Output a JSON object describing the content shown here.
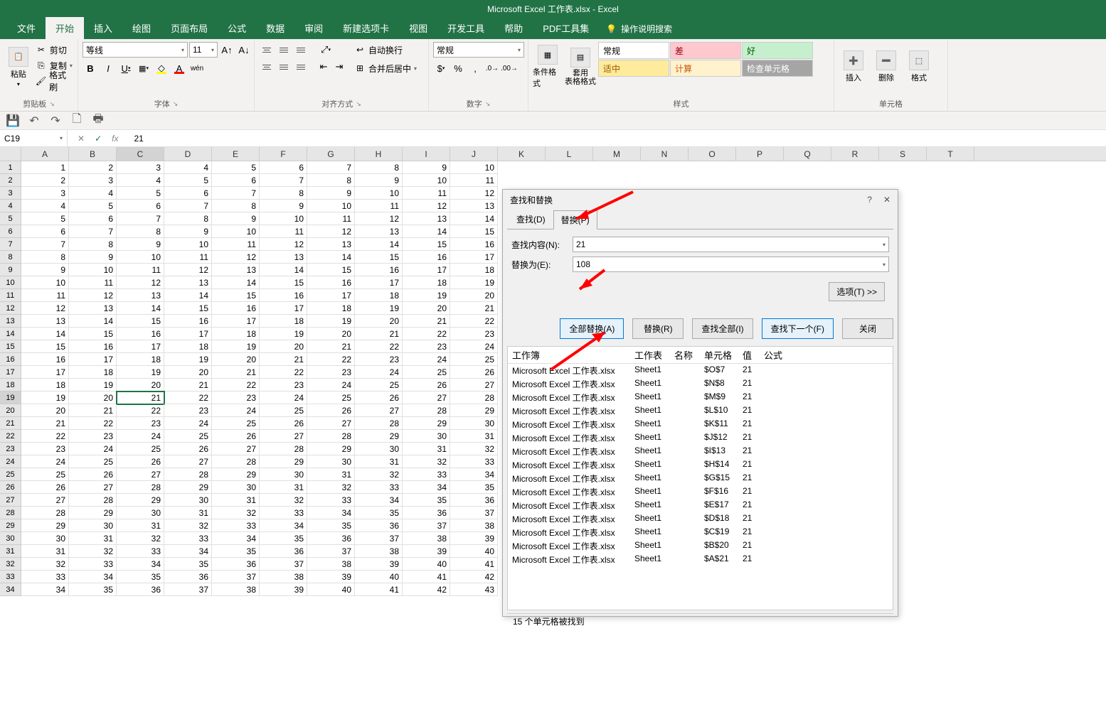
{
  "title": "Microsoft Excel 工作表.xlsx  -  Excel",
  "menu": [
    "文件",
    "开始",
    "插入",
    "绘图",
    "页面布局",
    "公式",
    "数据",
    "审阅",
    "新建选项卡",
    "视图",
    "开发工具",
    "帮助",
    "PDF工具集"
  ],
  "menu_active": 1,
  "tell_me": "操作说明搜索",
  "ribbon": {
    "clipboard": {
      "label": "剪贴板",
      "paste": "粘贴",
      "cut": "剪切",
      "copy": "复制",
      "format_painter": "格式刷"
    },
    "font": {
      "label": "字体",
      "name": "等线",
      "size": "11"
    },
    "align": {
      "label": "对齐方式",
      "wrap": "自动换行",
      "merge": "合并后居中"
    },
    "number": {
      "label": "数字",
      "format": "常规"
    },
    "styles": {
      "label": "样式",
      "cond": "条件格式",
      "table": "套用\n表格格式",
      "cells": [
        {
          "t": "常规",
          "bg": "#ffffff",
          "c": "#000"
        },
        {
          "t": "差",
          "bg": "#ffc7ce",
          "c": "#9c0006"
        },
        {
          "t": "好",
          "bg": "#c6efce",
          "c": "#006100"
        },
        {
          "t": "适中",
          "bg": "#ffeb9c",
          "c": "#9c5700"
        },
        {
          "t": "计算",
          "bg": "#fff2cc",
          "c": "#c65911"
        },
        {
          "t": "检查单元格",
          "bg": "#a5a5a5",
          "c": "#fff"
        }
      ]
    },
    "cells_group": {
      "label": "单元格",
      "insert": "插入",
      "delete": "删除",
      "format": "格式"
    }
  },
  "namebox": "C19",
  "formula": "21",
  "columns": [
    "A",
    "B",
    "C",
    "D",
    "E",
    "F",
    "G",
    "H",
    "I",
    "J",
    "K",
    "L",
    "M",
    "N",
    "O",
    "P",
    "Q",
    "R",
    "S",
    "T"
  ],
  "active_cell": {
    "row": 19,
    "col": 3
  },
  "grid_rows": 34,
  "grid_cols": 10,
  "dialog": {
    "title": "查找和替换",
    "tabs": [
      "查找(D)",
      "替换(P)"
    ],
    "active_tab": 1,
    "find_label": "查找内容(N):",
    "find_value": "21",
    "replace_label": "替换为(E):",
    "replace_value": "108",
    "options": "选项(T) >>",
    "buttons": [
      "全部替换(A)",
      "替换(R)",
      "查找全部(I)",
      "查找下一个(F)",
      "关闭"
    ],
    "results_header": [
      "工作簿",
      "工作表",
      "名称",
      "单元格",
      "值",
      "公式"
    ],
    "results": [
      {
        "wb": "Microsoft Excel 工作表.xlsx",
        "ws": "Sheet1",
        "cell": "$O$7",
        "val": "21"
      },
      {
        "wb": "Microsoft Excel 工作表.xlsx",
        "ws": "Sheet1",
        "cell": "$N$8",
        "val": "21"
      },
      {
        "wb": "Microsoft Excel 工作表.xlsx",
        "ws": "Sheet1",
        "cell": "$M$9",
        "val": "21"
      },
      {
        "wb": "Microsoft Excel 工作表.xlsx",
        "ws": "Sheet1",
        "cell": "$L$10",
        "val": "21"
      },
      {
        "wb": "Microsoft Excel 工作表.xlsx",
        "ws": "Sheet1",
        "cell": "$K$11",
        "val": "21"
      },
      {
        "wb": "Microsoft Excel 工作表.xlsx",
        "ws": "Sheet1",
        "cell": "$J$12",
        "val": "21"
      },
      {
        "wb": "Microsoft Excel 工作表.xlsx",
        "ws": "Sheet1",
        "cell": "$I$13",
        "val": "21"
      },
      {
        "wb": "Microsoft Excel 工作表.xlsx",
        "ws": "Sheet1",
        "cell": "$H$14",
        "val": "21"
      },
      {
        "wb": "Microsoft Excel 工作表.xlsx",
        "ws": "Sheet1",
        "cell": "$G$15",
        "val": "21"
      },
      {
        "wb": "Microsoft Excel 工作表.xlsx",
        "ws": "Sheet1",
        "cell": "$F$16",
        "val": "21"
      },
      {
        "wb": "Microsoft Excel 工作表.xlsx",
        "ws": "Sheet1",
        "cell": "$E$17",
        "val": "21"
      },
      {
        "wb": "Microsoft Excel 工作表.xlsx",
        "ws": "Sheet1",
        "cell": "$D$18",
        "val": "21"
      },
      {
        "wb": "Microsoft Excel 工作表.xlsx",
        "ws": "Sheet1",
        "cell": "$C$19",
        "val": "21"
      },
      {
        "wb": "Microsoft Excel 工作表.xlsx",
        "ws": "Sheet1",
        "cell": "$B$20",
        "val": "21"
      },
      {
        "wb": "Microsoft Excel 工作表.xlsx",
        "ws": "Sheet1",
        "cell": "$A$21",
        "val": "21"
      }
    ],
    "status": "15 个单元格被找到"
  }
}
